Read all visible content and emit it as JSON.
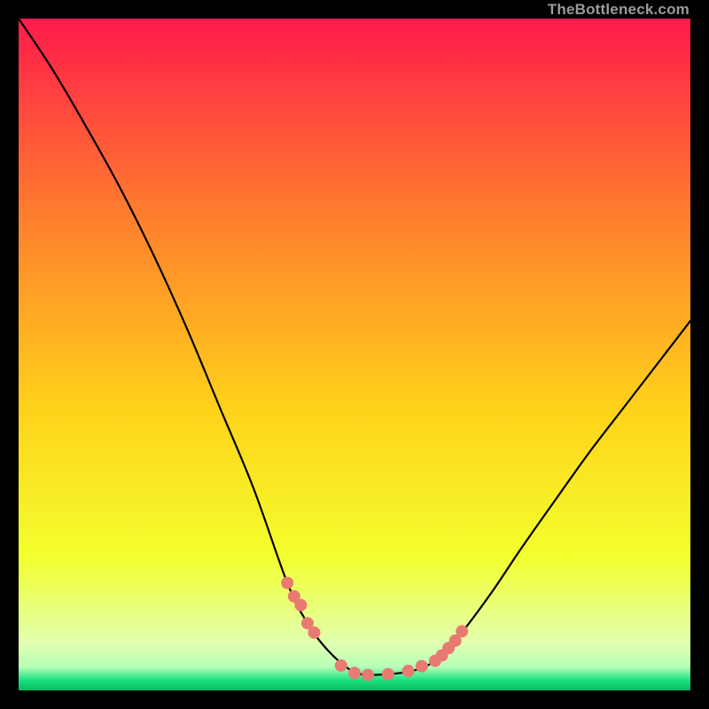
{
  "watermark": {
    "text": "TheBottleneck.com"
  },
  "colors": {
    "top": "#ff1a4b",
    "mid_upper": "#ff7a2f",
    "mid": "#ffd21a",
    "mid_lower": "#f3ff2d",
    "band": "#e1ffb0",
    "green": "#18e07e",
    "curve": "#000000",
    "dot": "#e97a72",
    "bg": "#000000"
  },
  "chart_data": {
    "type": "line",
    "title": "",
    "xlabel": "",
    "ylabel": "",
    "xlim": [
      0,
      100
    ],
    "ylim": [
      0,
      100
    ],
    "grid": false,
    "legend": false,
    "annotations": [],
    "series": [
      {
        "name": "bottleneck-curve",
        "x": [
          0,
          5,
          10,
          15,
          20,
          25,
          30,
          35,
          40,
          43,
          46,
          49,
          51,
          53,
          56,
          59,
          62,
          65,
          70,
          75,
          80,
          85,
          90,
          95,
          100
        ],
        "y": [
          100,
          92.5,
          84,
          75,
          65,
          54,
          42,
          30,
          16,
          10,
          6,
          3.3,
          2.4,
          2.3,
          2.5,
          3.0,
          4.4,
          7.4,
          14,
          21.4,
          28.5,
          35.5,
          42,
          48.5,
          55
        ]
      }
    ],
    "highlight_dots": {
      "name": "near-optimal-points",
      "x": [
        40,
        41,
        42,
        43,
        44,
        48,
        50,
        52,
        55,
        58,
        60,
        62,
        63,
        64,
        65,
        66
      ],
      "y": [
        16,
        14,
        12.7,
        10,
        8.6,
        3.7,
        2.6,
        2.3,
        2.4,
        2.9,
        3.6,
        4.4,
        5.2,
        6.3,
        7.4,
        8.8
      ]
    },
    "optimal_band_y": [
      0,
      3.3
    ]
  }
}
